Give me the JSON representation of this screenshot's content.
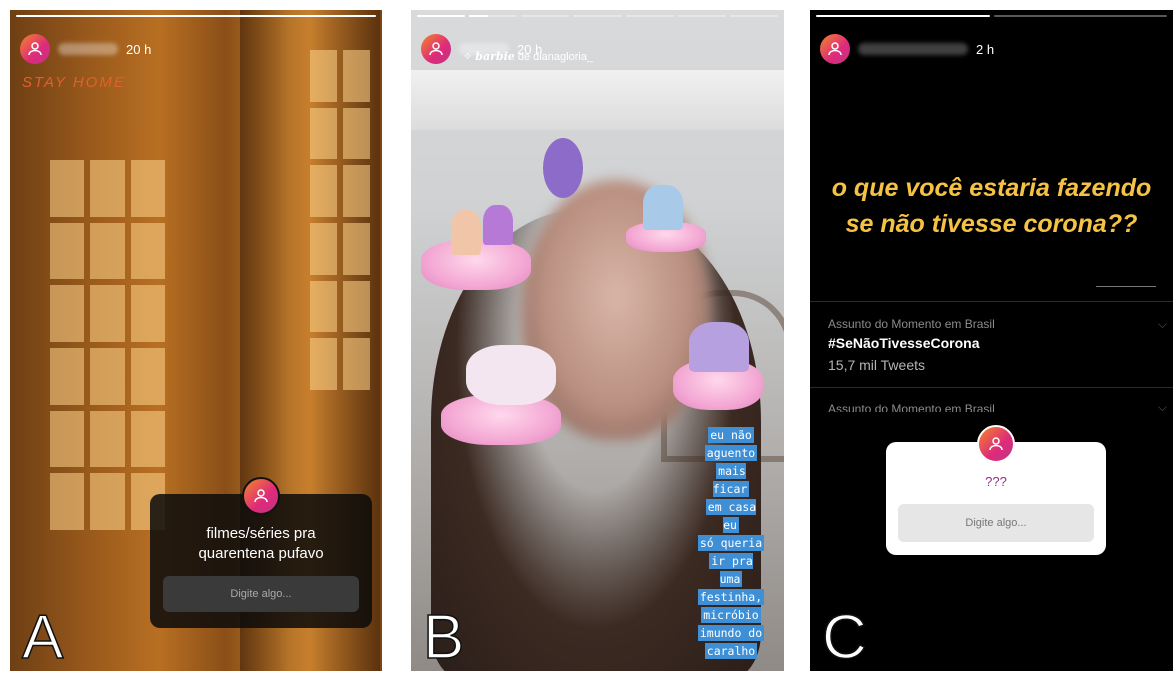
{
  "panels": {
    "a": {
      "time": "20 h",
      "sticker": "STAY HOME",
      "question": "filmes/séries pra quarentena pufavo",
      "input_placeholder": "Digite algo...",
      "label": "A",
      "progress": [
        1.0
      ]
    },
    "b": {
      "time": "20 h",
      "filter_prefix": "barbie",
      "filter_suffix": "de dianagloria_",
      "caption": [
        "eu não",
        "aguento",
        "mais ficar",
        "em casa eu",
        "só queria",
        "ir pra uma",
        "festinha,",
        "micróbio",
        "imundo do",
        "caralho"
      ],
      "label": "B",
      "progress": [
        1.0,
        0.4,
        0,
        0,
        0,
        0,
        0
      ]
    },
    "c": {
      "time": "2 h",
      "headline": "o que você estaria fazendo se não tivesse corona??",
      "trend1": {
        "subtitle": "Assunto do Momento em Brasil",
        "hashtag": "#SeNãoTivesseCorona",
        "count": "15,7 mil Tweets"
      },
      "trend2": {
        "subtitle": "Assunto do Momento em Brasil"
      },
      "question": "???",
      "input_placeholder": "Digite algo...",
      "label": "C",
      "progress": [
        1.0,
        0
      ]
    }
  },
  "colors": {
    "avatar_gradient": [
      "#f58529",
      "#dd2a7b"
    ],
    "sticker_orange": "#e0602a",
    "headline_yellow": "#f6c244",
    "question_purple": "#9b2b86",
    "caption_blue": "#3e8fd6"
  }
}
